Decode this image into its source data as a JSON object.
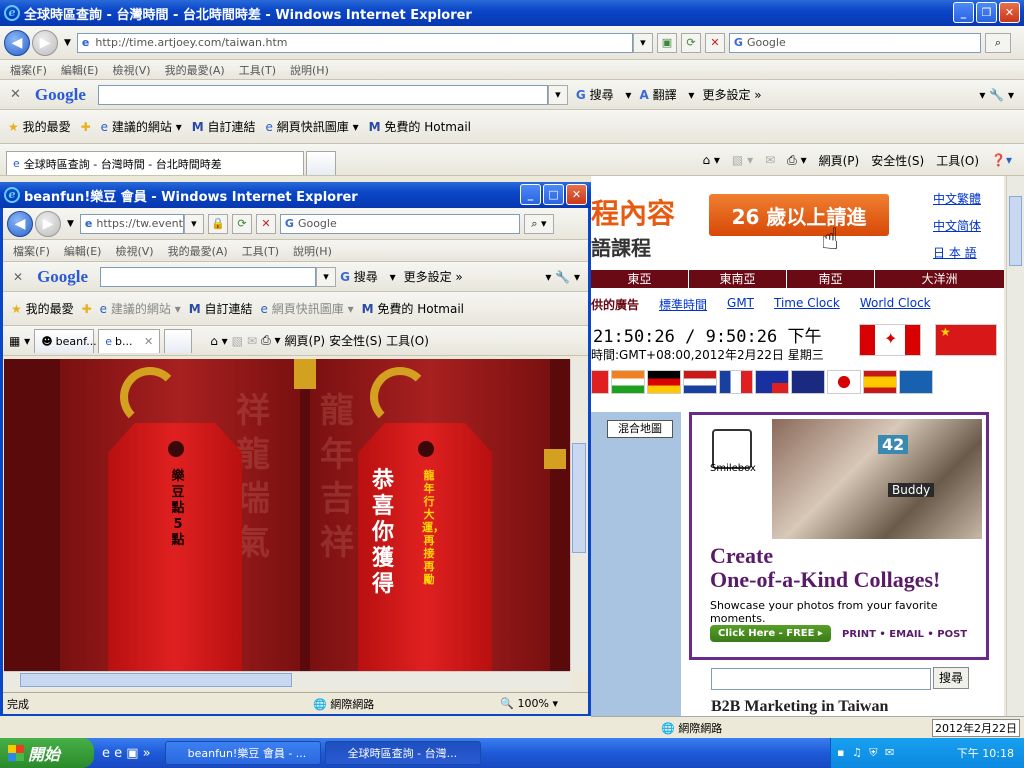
{
  "main_window": {
    "title": "全球時區查詢 - 台灣時間 - 台北時間時差 - Windows Internet Explorer",
    "url": "http://time.artjoey.com/taiwan.htm",
    "search_placeholder": "Google",
    "menu": [
      "檔案(F)",
      "編輯(E)",
      "檢視(V)",
      "我的最愛(A)",
      "工具(T)",
      "說明(H)"
    ],
    "google_bar": {
      "logo": "Google",
      "search": "搜尋",
      "translate": "翻譯",
      "more": "更多設定 »"
    },
    "favorites": {
      "label": "我的最愛",
      "items": [
        "建議的網站",
        "自訂連結",
        "網頁快訊圖庫",
        "免費的 Hotmail"
      ]
    },
    "tab_title": "全球時區查詢 - 台灣時間 - 台北時間時差",
    "cmd_items": [
      "網頁(P)",
      "安全性(S)",
      "工具(O)"
    ],
    "status_zone": "網際網路",
    "status_date": "2012年2月22日"
  },
  "page": {
    "banner_text": "程內容",
    "banner_sub": "語課程",
    "ad_button": "26 歲以上請進",
    "lang_links": [
      "中文繁體",
      "中文简体",
      "日 本 語"
    ],
    "regions": [
      "東亞",
      "東南亞",
      "南亞",
      "大洋洲"
    ],
    "nav_links": [
      "供的廣告",
      "標準時間",
      "GMT",
      "Time Clock",
      "World Clock"
    ],
    "clock": "21:50:26 / 9:50:26 下午",
    "date_line": "時間:GMT+08:00,2012年2月22日 星期三",
    "map_button": "混合地圖",
    "ad_brand": "Smilebox",
    "ad_headline1": "Create",
    "ad_headline2": "One-of-a-Kind Collages!",
    "ad_sub": "Showcase your photos from your favorite moments.",
    "ad_cta": "Click Here - FREE ▸",
    "ad_footer": "PRINT • EMAIL • POST",
    "ad_photo_label": "Buddy",
    "ad_photo_num": "42",
    "search_btn": "搜尋",
    "bottom_banner": "B2B Marketing in Taiwan"
  },
  "popup": {
    "title": "beanfun!樂豆 會員 - Windows Internet Explorer",
    "url": "https://tw.event.b",
    "search_placeholder": "Google",
    "menu": [
      "檔案(F)",
      "編輯(E)",
      "檢視(V)",
      "我的最愛(A)",
      "工具(T)",
      "說明(H)"
    ],
    "google_search": "搜尋",
    "google_more": "更多設定 »",
    "favorites": {
      "label": "我的最愛",
      "items": [
        "建議的網站",
        "自訂連結",
        "網頁快訊圖庫",
        "免費的 Hotmail"
      ]
    },
    "tabs": [
      "beanf...",
      "b..."
    ],
    "cmd_items": [
      "網頁(P)",
      "安全性(S)",
      "工具(O)"
    ],
    "tag_left": "樂豆點5點",
    "tag_right_main": "恭喜你獲得",
    "tag_right_side": "龍年行大運，再接再勵",
    "bg_chars_left": "祥龍瑞氣",
    "bg_chars_right": "龍年吉祥",
    "status_done": "完成",
    "status_zone": "網際網路",
    "zoom": "100%"
  },
  "taskbar": {
    "start": "開始",
    "tasks": [
      "beanfun!樂豆 會員 - ...",
      "全球時區查詢 - 台灣..."
    ],
    "time": "下午 10:18"
  },
  "colors": {
    "xp_blue": "#0a46c8",
    "tag_red": "#c81818",
    "gold": "#d4a020",
    "banner_orange": "#e85a10",
    "region_bar": "#6a0a14"
  }
}
